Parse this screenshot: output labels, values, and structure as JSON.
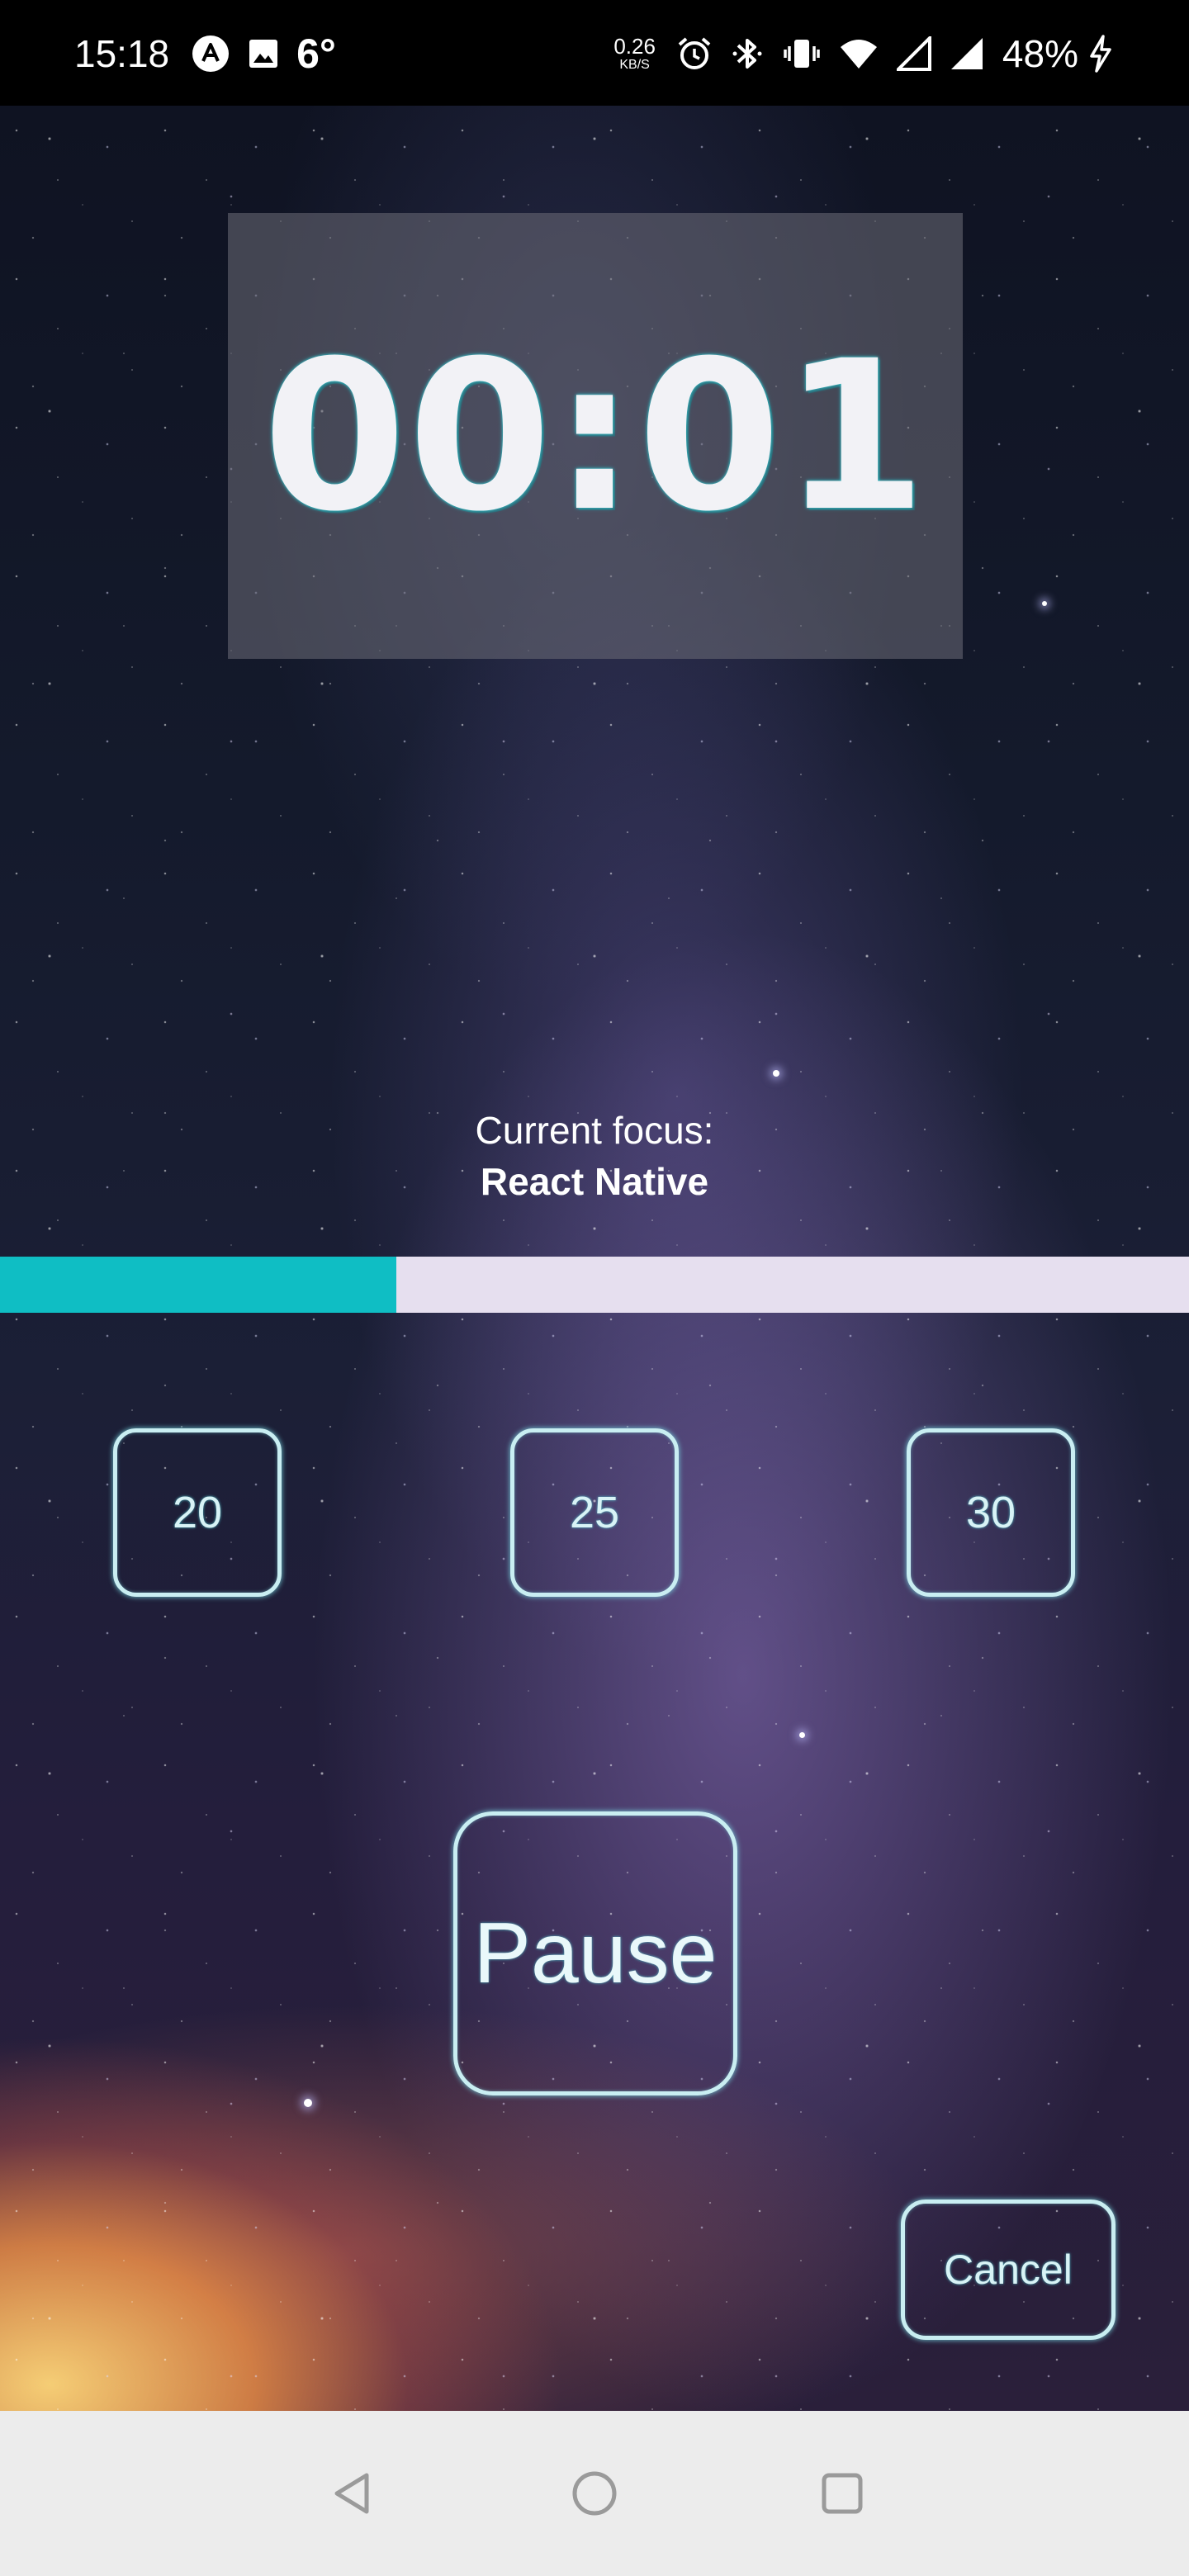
{
  "status_bar": {
    "time": "15:18",
    "temperature": "6°",
    "net_speed_value": "0.26",
    "net_speed_unit": "KB/S",
    "battery": "48%",
    "icons": [
      "app-a-icon",
      "image-icon",
      "alarm-icon",
      "bluetooth-icon",
      "vibrate-icon",
      "wifi-icon",
      "signal-icon",
      "charging-icon"
    ]
  },
  "timer": {
    "display": "00:01"
  },
  "focus": {
    "label": "Current focus:",
    "subject": "React Native"
  },
  "progress": {
    "fraction": 0.333,
    "fill_color": "#0fbec4",
    "track_color": "#e6dfef"
  },
  "time_options": [
    "20",
    "25",
    "30"
  ],
  "controls": {
    "pause_label": "Pause",
    "cancel_label": "Cancel"
  },
  "nav_bar": {
    "buttons": [
      "back-icon",
      "home-icon",
      "recents-icon"
    ]
  }
}
